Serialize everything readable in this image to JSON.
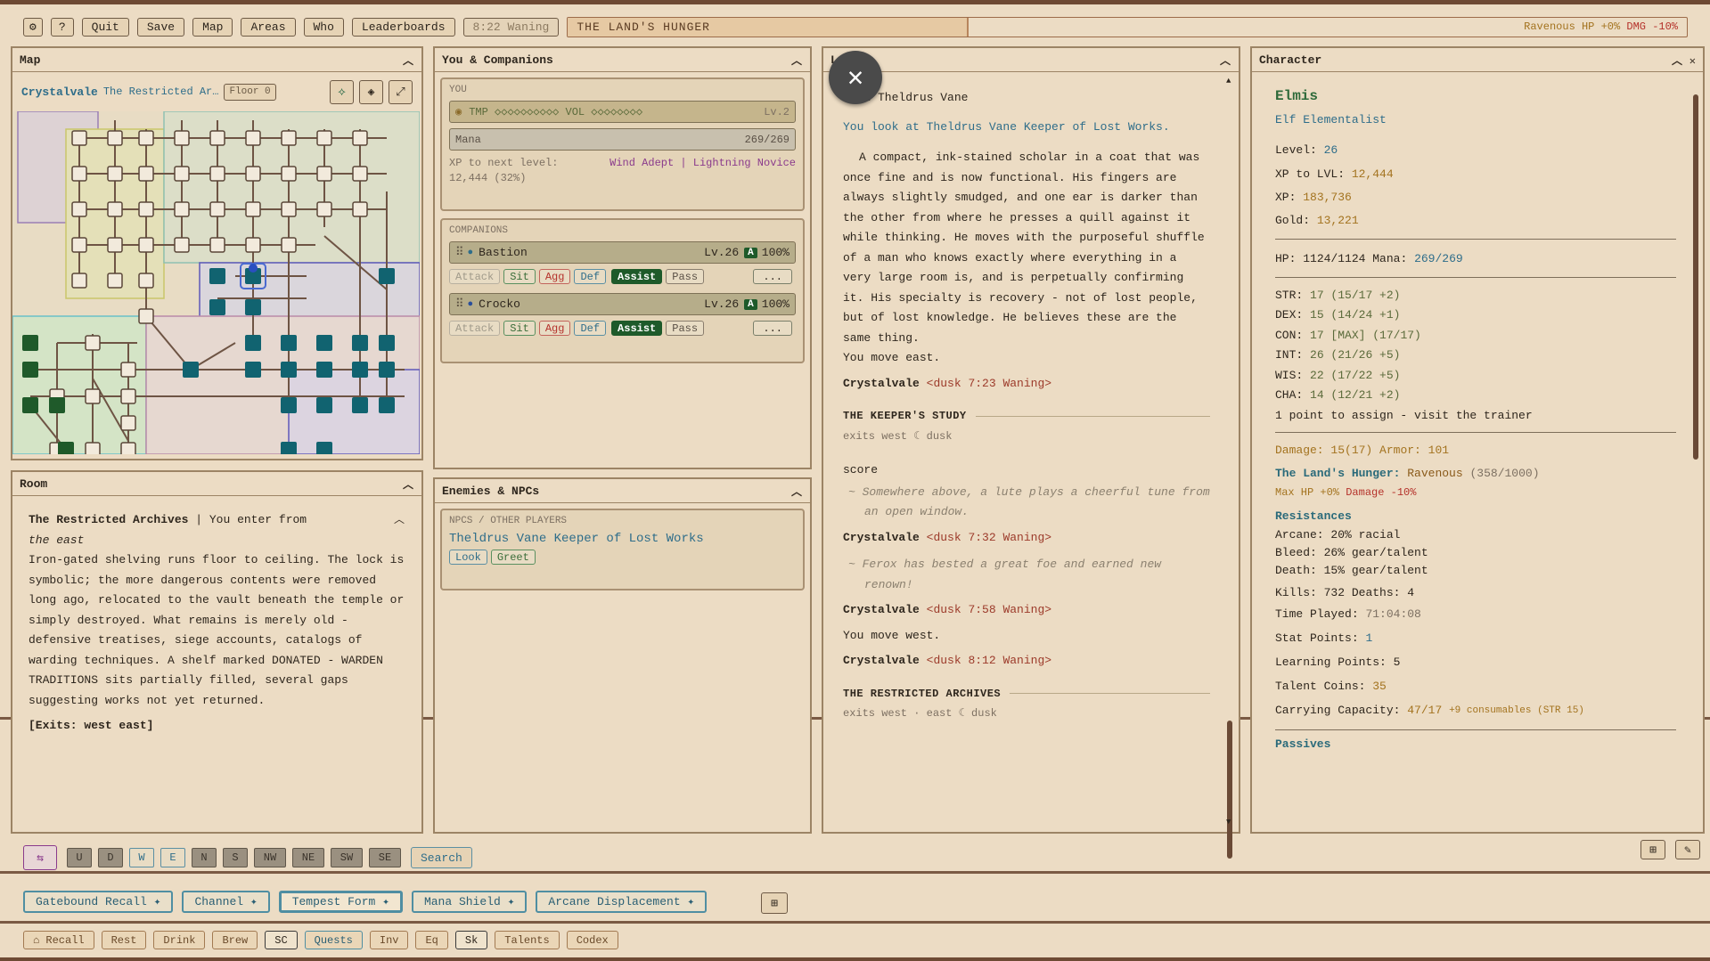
{
  "topbar": {
    "quit": "Quit",
    "save": "Save",
    "map": "Map",
    "areas": "Areas",
    "who": "Who",
    "leaderboards": "Leaderboards",
    "help": "?",
    "time": "8:22 Waning",
    "hunger_title": "THE LAND'S HUNGER",
    "hunger_fraction": 0.358,
    "hunger_status": "Ravenous",
    "hunger_hp": "HP +0%",
    "hunger_dmg": "DMG -10%"
  },
  "map": {
    "title": "Map",
    "zone": "Crystalvale",
    "area": "The Restricted Ar…",
    "floor": "Floor 0"
  },
  "room": {
    "title": "Room",
    "name": "The Restricted Archives",
    "enter": "You enter from",
    "enter_dir": "the east",
    "description": "Iron-gated shelving runs floor to ceiling. The lock is symbolic; the more dangerous contents were removed long ago, relocated to the vault beneath the temple or simply destroyed. What remains is merely old - defensive treatises, siege accounts, catalogs of warding techniques. A shelf marked DONATED - WARDEN TRADITIONS sits partially filled, several gaps suggesting works not yet returned.",
    "exits": "[Exits: west east]"
  },
  "you": {
    "title": "You & Companions",
    "you_label": "YOU",
    "tmp_label": "TMP ◇◇◇◇◇◇◇◇◇◇ VOL ◇◇◇◇◇◇◇◇",
    "tmp_level": "Lv.2",
    "mana_label": "Mana",
    "mana_value": "269/269",
    "xp_label": "XP to next level:",
    "xp_value": "12,444 (32%)",
    "rank1": "Wind Adept",
    "sep": "|",
    "rank2": "Lightning Novice",
    "companions_label": "COMPANIONS",
    "companions": [
      {
        "name": "Bastion",
        "level": "Lv.26",
        "badge": "A",
        "pct": "100%"
      },
      {
        "name": "Crocko",
        "level": "Lv.26",
        "badge": "A",
        "pct": "100%"
      }
    ],
    "cbuttons": {
      "attack": "Attack",
      "sit": "Sit",
      "agg": "Agg",
      "def": "Def",
      "assist": "Assist",
      "pass": "Pass",
      "more": "..."
    }
  },
  "enemies": {
    "title": "Enemies & NPCs",
    "section": "NPCS / OTHER PLAYERS",
    "npc": "Theldrus Vane Keeper of Lost Works",
    "look": "Look",
    "greet": "Greet"
  },
  "log": {
    "title": "Log",
    "cmd_look": "look Theldrus Vane",
    "look_result": "You look at Theldrus Vane Keeper of Lost Works.",
    "desc": "A compact, ink-stained scholar in a coat that was once fine and is now functional. His fingers are always slightly smudged, and one ear is darker than the other from where he presses a quill against it while thinking. He moves with the purposeful shuffle of a man who knows exactly where everything in a very large room is, and is perpetually confirming it. His specialty is recovery - not of lost people, but of lost knowledge. He believes these are the same thing.",
    "move_east": "You move east.",
    "p1_zone": "Crystalvale",
    "p1_time": "<dusk 7:23 Waning>",
    "room1": "THE KEEPER'S STUDY",
    "room1_exits": "exits west  ☾ dusk",
    "cmd_score": "score",
    "flavor1": "~ Somewhere above, a lute plays a cheerful tune from an open window.",
    "p2_zone": "Crystalvale",
    "p2_time": "<dusk 7:32 Waning>",
    "flavor2": "~ Ferox has bested a great foe and earned new renown!",
    "p3_zone": "Crystalvale",
    "p3_time": "<dusk 7:58 Waning>",
    "move_west": "You move west.",
    "p4_zone": "Crystalvale",
    "p4_time": "<dusk 8:12 Waning>",
    "room2": "THE RESTRICTED ARCHIVES",
    "room2_exits": "exits west · east  ☾ dusk"
  },
  "character": {
    "title": "Character",
    "name": "Elmis",
    "race_class": "Elf Elementalist",
    "level_label": "Level:",
    "level": "26",
    "xptolvl_label": "XP to LVL:",
    "xptolvl": "12,444",
    "xp_label": "XP:",
    "xp": "183,736",
    "gold_label": "Gold:",
    "gold": "13,221",
    "hp_label": "HP:",
    "hp": "1124/1124",
    "mana_label": "Mana:",
    "mana": "269/269",
    "stats": [
      {
        "k": "STR:",
        "v": "17 (15/17 +2)"
      },
      {
        "k": "DEX:",
        "v": "15 (14/24 +1)"
      },
      {
        "k": "CON:",
        "v": "17 [MAX] (17/17)"
      },
      {
        "k": "INT:",
        "v": "26 (21/26 +5)"
      },
      {
        "k": "WIS:",
        "v": "22 (17/22 +5)"
      },
      {
        "k": "CHA:",
        "v": "14 (12/21 +2)"
      }
    ],
    "assign": "1 point to assign - visit the trainer",
    "damage_label": "Damage:",
    "damage": "15(17)",
    "armor_label": "Armor:",
    "armor": "101",
    "hunger_label": "The Land's Hunger:",
    "hunger_status": "Ravenous",
    "hunger_val": "(358/1000)",
    "maxhp": "Max HP +0%",
    "dmgmod": "Damage -10%",
    "resist_title": "Resistances",
    "resists": [
      {
        "k": "Arcane:",
        "v": "20% racial"
      },
      {
        "k": "Bleed:",
        "v": "26% gear/talent"
      },
      {
        "k": "Death:",
        "v": "15% gear/talent"
      }
    ],
    "kills_label": "Kills:",
    "kills": "732",
    "deaths_label": "Deaths:",
    "deaths": "4",
    "time_label": "Time Played:",
    "time": "71:04:08",
    "statpts_label": "Stat Points:",
    "statpts": "1",
    "learn_label": "Learning Points:",
    "learn": "5",
    "coins_label": "Talent Coins:",
    "coins": "35",
    "carry_label": "Carrying Capacity:",
    "carry": "47/17",
    "carry_extra": "+9 consumables (STR 15)",
    "passives": "Passives"
  },
  "nav": {
    "swap": "⇆",
    "dirs": [
      "U",
      "D",
      "W",
      "E",
      "N",
      "S",
      "NW",
      "NE",
      "SW",
      "SE"
    ],
    "search": "Search"
  },
  "spells": [
    "Gatebound Recall ✦",
    "Channel ✦",
    "Tempest Form ✦",
    "Mana Shield ✦",
    "Arcane Displacement ✦"
  ],
  "quick": [
    "⌂ Recall",
    "Rest",
    "Drink",
    "Brew",
    "SC",
    "Quests",
    "Inv",
    "Eq",
    "Sk",
    "Talents",
    "Codex"
  ]
}
